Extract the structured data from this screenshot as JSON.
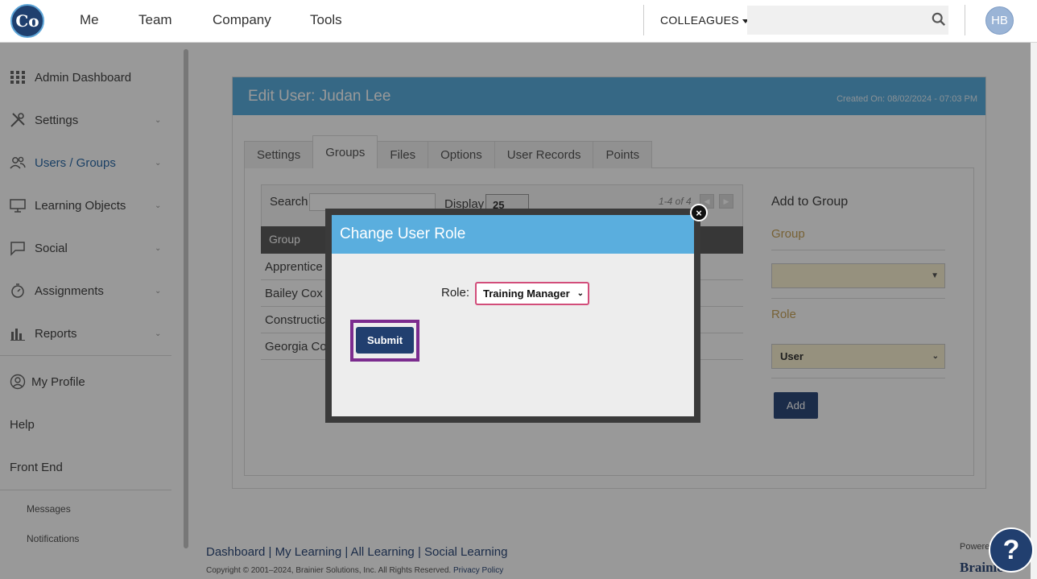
{
  "topbar": {
    "logo_text": "Co",
    "nav": [
      "Me",
      "Team",
      "Company",
      "Tools"
    ],
    "colleagues_label": "COLLEAGUES",
    "search_placeholder": "",
    "avatar_initials": "HB"
  },
  "sidebar": {
    "items": [
      {
        "label": "Admin Dashboard",
        "icon": "grid-icon"
      },
      {
        "label": "Settings",
        "icon": "tools-icon"
      },
      {
        "label": "Users / Groups",
        "icon": "users-icon"
      },
      {
        "label": "Learning Objects",
        "icon": "monitor-icon"
      },
      {
        "label": "Social",
        "icon": "chat-icon"
      },
      {
        "label": "Assignments",
        "icon": "stopwatch-icon"
      },
      {
        "label": "Reports",
        "icon": "bar-chart-icon"
      }
    ],
    "my_profile": "My Profile",
    "help": "Help",
    "front_end": "Front End",
    "messages": "Messages",
    "notifications": "Notifications"
  },
  "panel": {
    "title": "Edit User: Judan Lee",
    "created": "Created On: 08/02/2024 - 07:03 PM",
    "tabs": [
      "Settings",
      "Groups",
      "Files",
      "Options",
      "User Records",
      "Points"
    ],
    "active_tab": "Groups"
  },
  "grid": {
    "search_label": "Search",
    "display_label": "Display",
    "display_value": "25",
    "count": "1-4 of 4",
    "column_header": "Group",
    "rows": [
      "Apprentice",
      "Bailey Cox",
      "Constructic",
      "Georgia Co"
    ]
  },
  "add_group": {
    "title": "Add to Group",
    "group_label": "Group",
    "group_value": "",
    "role_label": "Role",
    "role_value": "User",
    "add_button": "Add"
  },
  "footer": {
    "links": "Dashboard | My Learning | All Learning | Social Learning",
    "copyright": "Copyright © 2001–2024, Brainier Solutions, Inc. All Rights Reserved.",
    "privacy": "Privacy Policy",
    "powered": "Powere",
    "brand": "Brainie"
  },
  "modal": {
    "title": "Change User Role",
    "role_label": "Role:",
    "role_value": "Training Manager",
    "submit": "Submit",
    "close": "×"
  },
  "help_bubble": "?"
}
